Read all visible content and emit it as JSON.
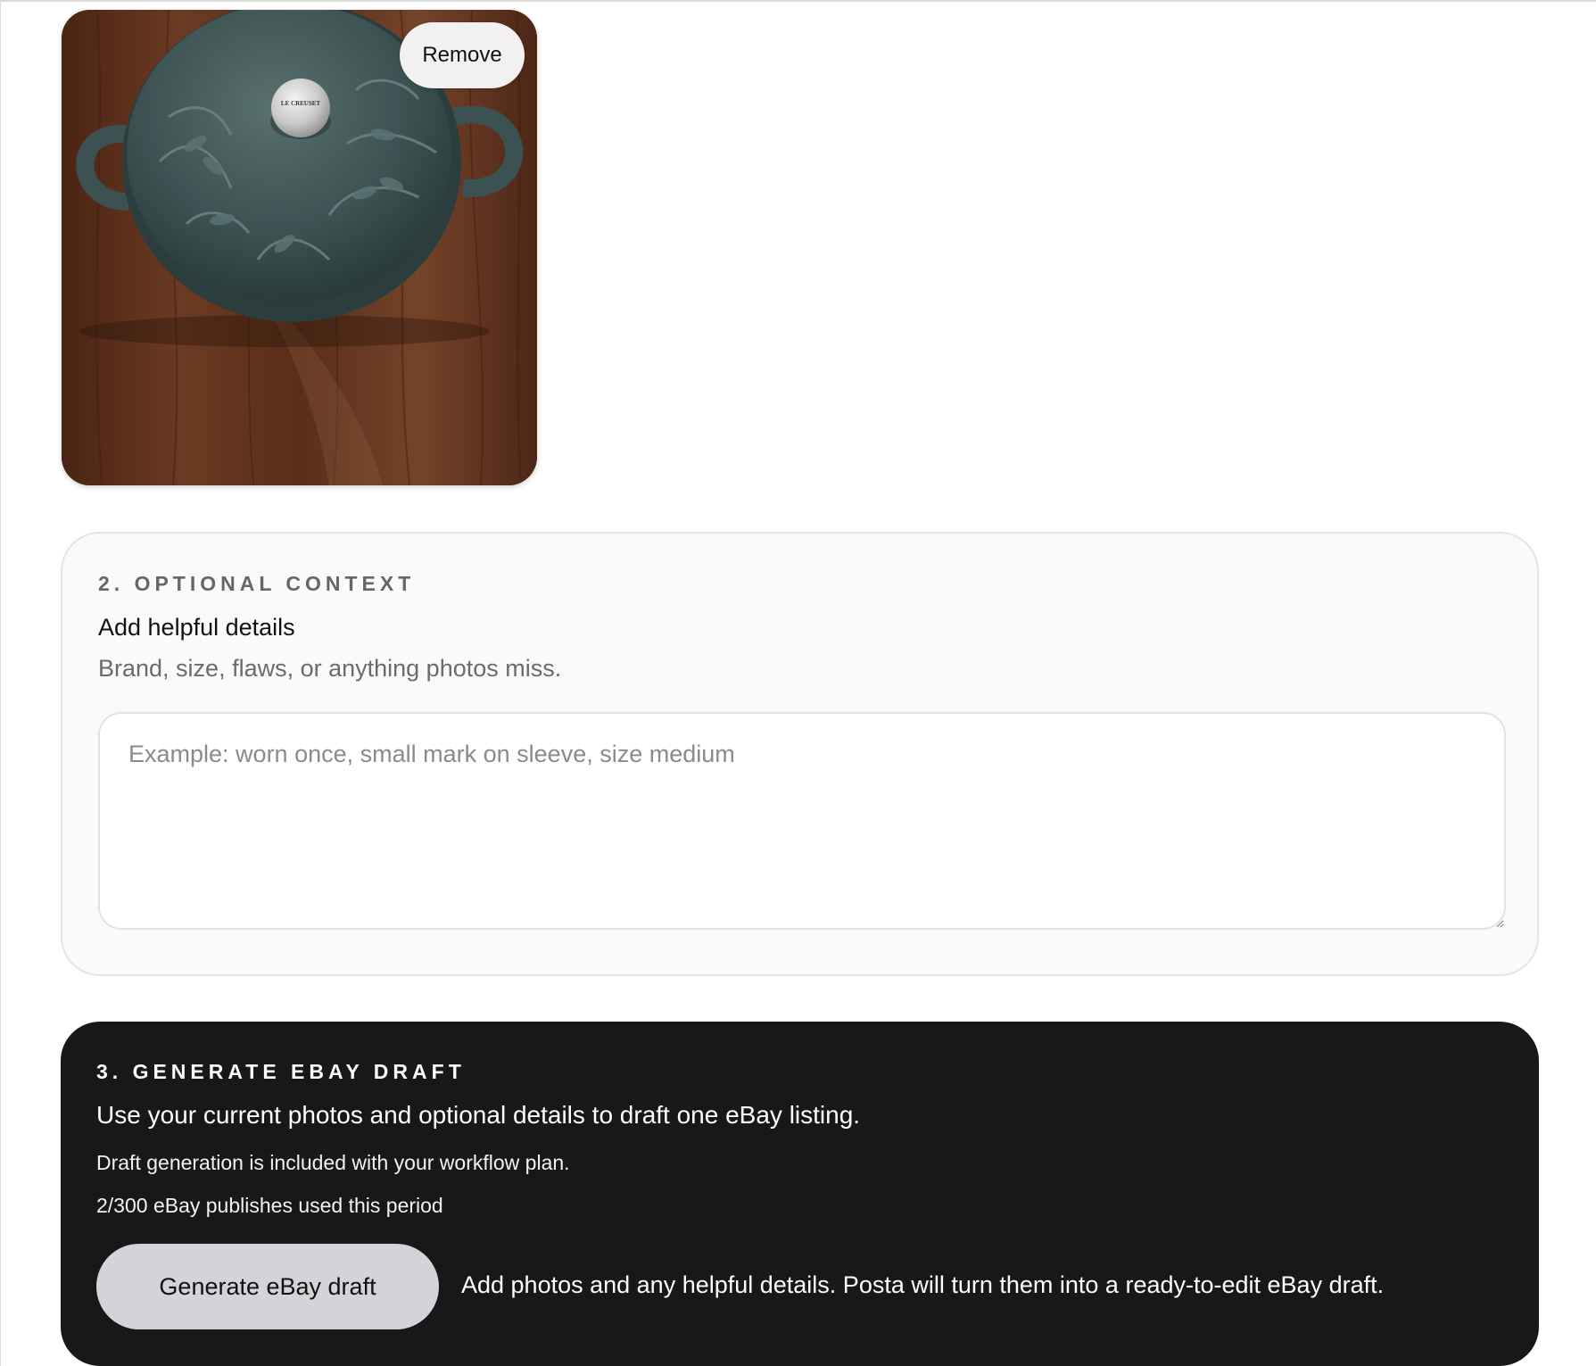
{
  "photo": {
    "alt_icon": "le-creuset-pot-photo",
    "remove_label": "Remove",
    "pot_knob_text": "LE CREUSET"
  },
  "context": {
    "eyebrow": "2. OPTIONAL CONTEXT",
    "title": "Add helpful details",
    "subtitle": "Brand, size, flaws, or anything photos miss.",
    "input_value": "",
    "input_placeholder": "Example: worn once, small mark on sleeve, size medium"
  },
  "generate": {
    "eyebrow": "3. GENERATE EBAY DRAFT",
    "lead": "Use your current photos and optional details to draft one eBay listing.",
    "note": "Draft generation is included with your workflow plan.",
    "usage": "2/300 eBay publishes used this period",
    "button_label": "Generate eBay draft",
    "hint": "Add photos and any helpful details. Posta will turn them into a ready-to-edit eBay draft."
  },
  "colors": {
    "dark_panel": "#18181a",
    "button_gray": "#d4d4d8",
    "card_bg": "#fafafa",
    "muted_text": "#6b6b6b",
    "pot_green": "#3c5151",
    "wood": "#5a2f1a"
  }
}
